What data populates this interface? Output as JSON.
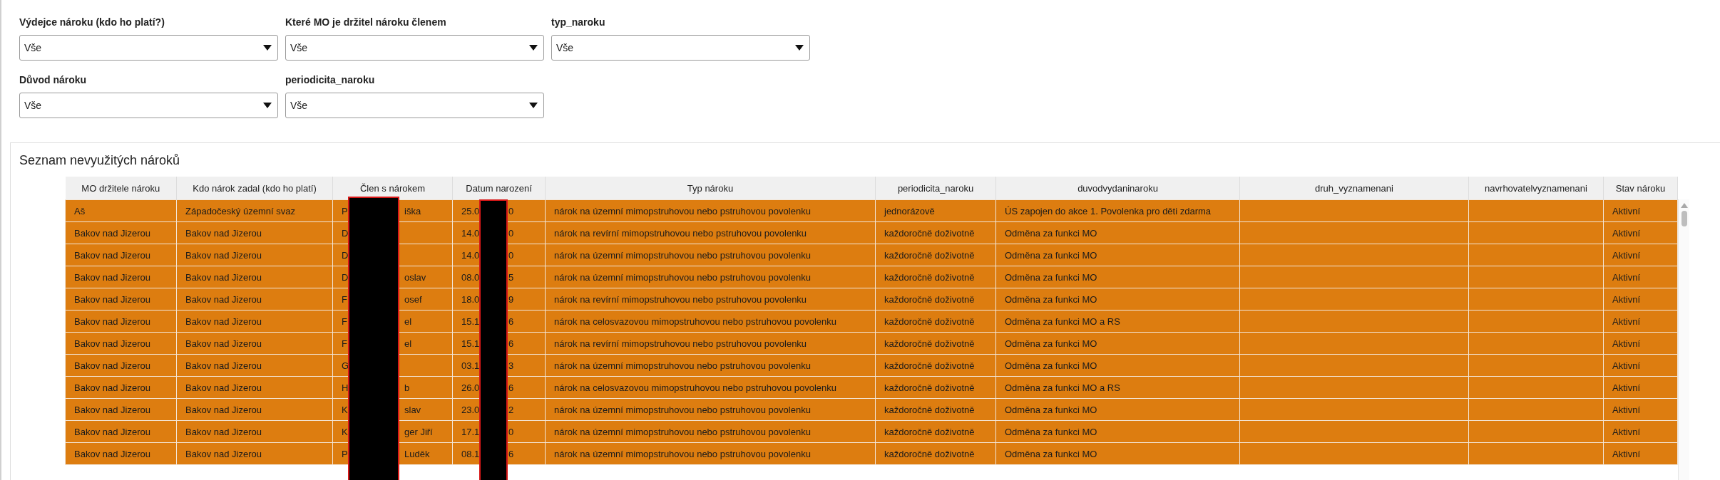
{
  "filter_rows": [
    [
      {
        "label": "Výdejce nároku (kdo ho platí?)",
        "value": "Vše"
      },
      {
        "label": "Které MO je držitel nároku členem",
        "value": "Vše"
      },
      {
        "label": "typ_naroku",
        "value": "Vše"
      }
    ],
    [
      {
        "label": "Důvod nároku",
        "value": "Vše"
      },
      {
        "label": "periodicita_naroku",
        "value": "Vše"
      }
    ]
  ],
  "panel": {
    "title": "Seznam nevyužitých nároků",
    "table": {
      "columns": [
        "MO držitele nároku",
        "Kdo nárok zadal (kdo ho platí)",
        "Člen s nárokem",
        "Datum narození",
        "Typ nároku",
        "periodicita_naroku",
        "duvodvydaninaroku",
        "druh_vyznamenani",
        "navrhovatelvyznamenani",
        "Stav nároku"
      ],
      "rows": [
        {
          "mo": "Aš",
          "zadal": "Západočeský územní svaz",
          "member": [
            "P",
            "iška"
          ],
          "birth": [
            "25.0",
            "0"
          ],
          "typ": "nárok na územní mimopstruhovou nebo pstruhovou povolenku",
          "periodicita": "jednorázově",
          "duvod": "ÚS zapojen do akce 1. Povolenka pro děti zdarma",
          "stav": "Aktivní"
        },
        {
          "mo": "Bakov nad Jizerou",
          "zadal": "Bakov nad Jizerou",
          "member": [
            "D"
          ],
          "birth": [
            "14.0",
            "0"
          ],
          "typ": "nárok na revírní mimopstruhovou nebo pstruhovou povolenku",
          "periodicita": "každoročně doživotně",
          "duvod": "Odměna za funkci MO",
          "stav": "Aktivní"
        },
        {
          "mo": "Bakov nad Jizerou",
          "zadal": "Bakov nad Jizerou",
          "member": [
            "D"
          ],
          "birth": [
            "14.0",
            "0"
          ],
          "typ": "nárok na územní mimopstruhovou nebo pstruhovou povolenku",
          "periodicita": "každoročně doživotně",
          "duvod": "Odměna za funkci MO",
          "stav": "Aktivní"
        },
        {
          "mo": "Bakov nad Jizerou",
          "zadal": "Bakov nad Jizerou",
          "member": [
            "D",
            "oslav"
          ],
          "birth": [
            "08.0",
            "5"
          ],
          "typ": "nárok na územní mimopstruhovou nebo pstruhovou povolenku",
          "periodicita": "každoročně doživotně",
          "duvod": "Odměna za funkci MO",
          "stav": "Aktivní"
        },
        {
          "mo": "Bakov nad Jizerou",
          "zadal": "Bakov nad Jizerou",
          "member": [
            "F",
            "osef"
          ],
          "birth": [
            "18.0",
            "9"
          ],
          "typ": "nárok na revírní mimopstruhovou nebo pstruhovou povolenku",
          "periodicita": "každoročně doživotně",
          "duvod": "Odměna za funkci MO",
          "stav": "Aktivní"
        },
        {
          "mo": "Bakov nad Jizerou",
          "zadal": "Bakov nad Jizerou",
          "member": [
            "F",
            "el"
          ],
          "birth": [
            "15.1",
            "6"
          ],
          "typ": "nárok na celosvazovou mimopstruhovou nebo pstruhovou povolenku",
          "periodicita": "každoročně doživotně",
          "duvod": "Odměna za funkci MO a RS",
          "stav": "Aktivní"
        },
        {
          "mo": "Bakov nad Jizerou",
          "zadal": "Bakov nad Jizerou",
          "member": [
            "F",
            "el"
          ],
          "birth": [
            "15.1",
            "6"
          ],
          "typ": "nárok na revírní mimopstruhovou nebo pstruhovou povolenku",
          "periodicita": "každoročně doživotně",
          "duvod": "Odměna za funkci MO",
          "stav": "Aktivní"
        },
        {
          "mo": "Bakov nad Jizerou",
          "zadal": "Bakov nad Jizerou",
          "member": [
            "G"
          ],
          "birth": [
            "03.1",
            "3"
          ],
          "typ": "nárok na územní mimopstruhovou nebo pstruhovou povolenku",
          "periodicita": "každoročně doživotně",
          "duvod": "Odměna za funkci MO",
          "stav": "Aktivní"
        },
        {
          "mo": "Bakov nad Jizerou",
          "zadal": "Bakov nad Jizerou",
          "member": [
            "H",
            "b"
          ],
          "birth": [
            "26.0",
            "6"
          ],
          "typ": "nárok na celosvazovou mimopstruhovou nebo pstruhovou povolenku",
          "periodicita": "každoročně doživotně",
          "duvod": "Odměna za funkci MO a RS",
          "stav": "Aktivní"
        },
        {
          "mo": "Bakov nad Jizerou",
          "zadal": "Bakov nad Jizerou",
          "member": [
            "K",
            "slav"
          ],
          "birth": [
            "23.0",
            "2"
          ],
          "typ": "nárok na územní mimopstruhovou nebo pstruhovou povolenku",
          "periodicita": "každoročně doživotně",
          "duvod": "Odměna za funkci MO",
          "stav": "Aktivní"
        },
        {
          "mo": "Bakov nad Jizerou",
          "zadal": "Bakov nad Jizerou",
          "member": [
            "K",
            "ger Jiří"
          ],
          "birth": [
            "17.1",
            "0"
          ],
          "typ": "nárok na územní mimopstruhovou nebo pstruhovou povolenku",
          "periodicita": "každoročně doživotně",
          "duvod": "Odměna za funkci MO",
          "stav": "Aktivní"
        },
        {
          "mo": "Bakov nad Jizerou",
          "zadal": "Bakov nad Jizerou",
          "member": [
            "P",
            "Luděk"
          ],
          "birth": [
            "08.1",
            "6"
          ],
          "typ": "nárok na územní mimopstruhovou nebo pstruhovou povolenku",
          "periodicita": "každoročně doživotně",
          "duvod": "Odměna za funkci MO",
          "stav": "Aktivní"
        }
      ]
    }
  }
}
